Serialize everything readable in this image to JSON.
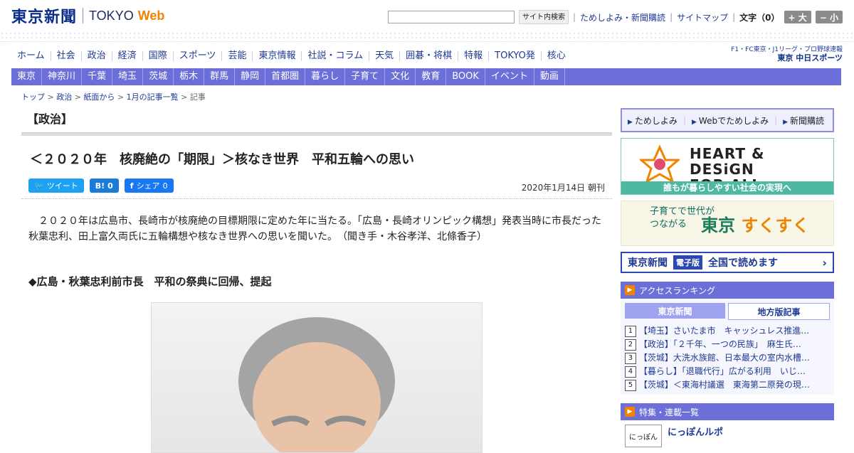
{
  "header": {
    "brand_jp": "東京新聞",
    "brand_en": "TOKYO",
    "brand_web": "Web",
    "search_label": "サイト内検索",
    "links": [
      "ためしよみ・新聞購読",
      "サイトマップ"
    ],
    "fontsize_label": "文字（0）",
    "size_plus": "+ 大",
    "size_minus": "− 小"
  },
  "nav_categories": [
    "ホーム",
    "社会",
    "政治",
    "経済",
    "国際",
    "スポーツ",
    "芸能",
    "東京情報",
    "社説・コラム",
    "天気",
    "囲碁・将棋",
    "特報",
    "TOKYO発",
    "核心"
  ],
  "chunichi": {
    "top": "F1・FC東京・J1リーグ・プロ野球速報",
    "bottom": "東京 中日スポーツ"
  },
  "nav_regions": [
    "東京",
    "神奈川",
    "千葉",
    "埼玉",
    "茨城",
    "栃木",
    "群馬",
    "静岡",
    "首都圏",
    "暮らし",
    "子育て",
    "文化",
    "教育",
    "BOOK",
    "イベント",
    "動画"
  ],
  "breadcrumb": [
    "トップ",
    "政治",
    "紙面から",
    "1月の記事一覧",
    "記事"
  ],
  "article": {
    "section": "【政治】",
    "headline": "＜２０２０年　核廃絶の「期限」＞核なき世界　平和五輪への思い",
    "share": {
      "tweet": "ツイート",
      "hatena": "B!",
      "hatena_count": "0",
      "fb": "シェア",
      "fb_count": "0"
    },
    "date": "2020年1月14日 朝刊",
    "lead": "２０２０年は広島市、長崎市が核廃絶の目標期限に定めた年に当たる。「広島・長崎オリンピック構想」発表当時に市長だった秋葉忠利、田上富久両氏に五輪構想や核なき世界への思いを聞いた。　（聞き手・木谷孝洋、北條香子）",
    "subhead": "◆広島・秋葉忠利前市長　平和の祭典に回帰、提起"
  },
  "sidebar": {
    "trial_links": [
      "ためしよみ",
      "Webでためしよみ",
      "新聞購読"
    ],
    "hd": {
      "title_line1": "HEART & DESiGN",
      "title_line2": "FOR ALL",
      "strip": "誰もが暮らしやすい社会の実現へ"
    },
    "sukusuku": {
      "small1": "子育てで世代が",
      "small2": "つながる",
      "big_a": "東京",
      "big_b": "すくすく"
    },
    "edition": {
      "name": "東京新聞",
      "tag": "電子版",
      "cta": "全国で読めます"
    },
    "ranking": {
      "title": "アクセスランキング",
      "tabs": [
        "東京新聞",
        "地方版記事"
      ],
      "items": [
        {
          "num": "1",
          "text": "【埼玉】さいたま市　キャッシュレス推進…"
        },
        {
          "num": "2",
          "text": "【政治】「２千年、一つの民族」　麻生氏…"
        },
        {
          "num": "3",
          "text": "【茨城】大洗水族館、日本最大の室内水槽…"
        },
        {
          "num": "4",
          "text": "【暮らし】「退職代行」広がる利用　いじ…"
        },
        {
          "num": "5",
          "text": "【茨城】＜東海村議選　東海第二原発の現…"
        }
      ]
    },
    "series": {
      "title": "特集・連載一覧",
      "card_thumb": "にっぽん",
      "card_title": "にっぽんルポ"
    }
  },
  "colors": {
    "nav": "#6d6fd8",
    "accent": "#f08300",
    "link": "#1f3a93"
  }
}
